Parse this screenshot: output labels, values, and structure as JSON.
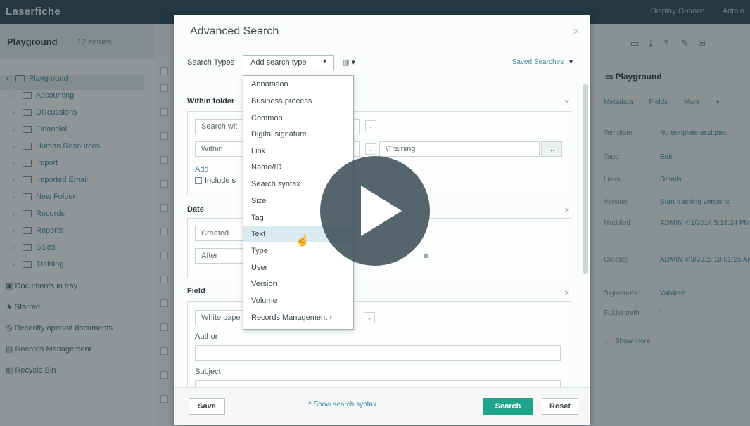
{
  "app": {
    "brand": "Laserfiche",
    "top_links": [
      "Display Options",
      "Admin"
    ]
  },
  "breadcrumb": {
    "title": "Playground",
    "count": "12 entries"
  },
  "sidebar": {
    "tree": [
      {
        "label": "Playground",
        "selected": true
      },
      {
        "label": "Accounting"
      },
      {
        "label": "Discussions"
      },
      {
        "label": "Financial"
      },
      {
        "label": "Human Resources"
      },
      {
        "label": "Import"
      },
      {
        "label": "Imported Email"
      },
      {
        "label": "New Folder"
      },
      {
        "label": "Records"
      },
      {
        "label": "Reports"
      },
      {
        "label": "Sales"
      },
      {
        "label": "Training"
      }
    ],
    "links": [
      "Documents in tray",
      "Starred",
      "Recently opened documents",
      "Records Management",
      "Recycle Bin"
    ]
  },
  "rightpanel": {
    "title": "Playground",
    "tabs": [
      "Metadata",
      "Fields",
      "More"
    ],
    "rows": [
      {
        "k": "Template",
        "v": "No template assigned"
      },
      {
        "k": "Tags",
        "v": "Edit"
      },
      {
        "k": "Links",
        "v": "Details"
      },
      {
        "k": "Version",
        "v": "Start tracking versions"
      },
      {
        "k": "Modified",
        "v": "ADMIN 4/1/2014 5:18:24 PM"
      },
      {
        "k": "Created",
        "v": "ADMIN 4/3/2015 10:01:25 AM"
      },
      {
        "k": "Signatures",
        "v": "Validate"
      },
      {
        "k": "Folder path",
        "v": "\\"
      }
    ],
    "show_more": "Show more"
  },
  "modal": {
    "title": "Advanced Search",
    "search_types_label": "Search Types",
    "add_search_type": "Add search type",
    "saved_searches": "Saved Searches",
    "sections": {
      "within_folder": {
        "title": "Within folder",
        "search_within": "Search wit",
        "within": "Within",
        "path": "\\Training",
        "browse": "...",
        "add": "Add",
        "include": "Include s"
      },
      "date": {
        "title": "Date",
        "created": "Created",
        "after": "After"
      },
      "field": {
        "title": "Field",
        "template": "White pape",
        "author": "Author",
        "subject": "Subject"
      }
    },
    "footer": {
      "save": "Save",
      "show_syntax": "Show search syntax",
      "search": "Search",
      "reset": "Reset"
    }
  },
  "dropdown": {
    "items": [
      "Annotation",
      "Business process",
      "Common",
      "Digital signature",
      "Link",
      "Name/ID",
      "Search syntax",
      "Size",
      "Tag",
      "Text",
      "Type",
      "User",
      "Version",
      "Volume",
      "Records Management"
    ],
    "highlighted": "Text"
  },
  "colors": {
    "topbar": "#2c4957",
    "accent": "#3f8aa0",
    "primary_button": "#1fa58b",
    "highlight": "#d9ebf1"
  }
}
